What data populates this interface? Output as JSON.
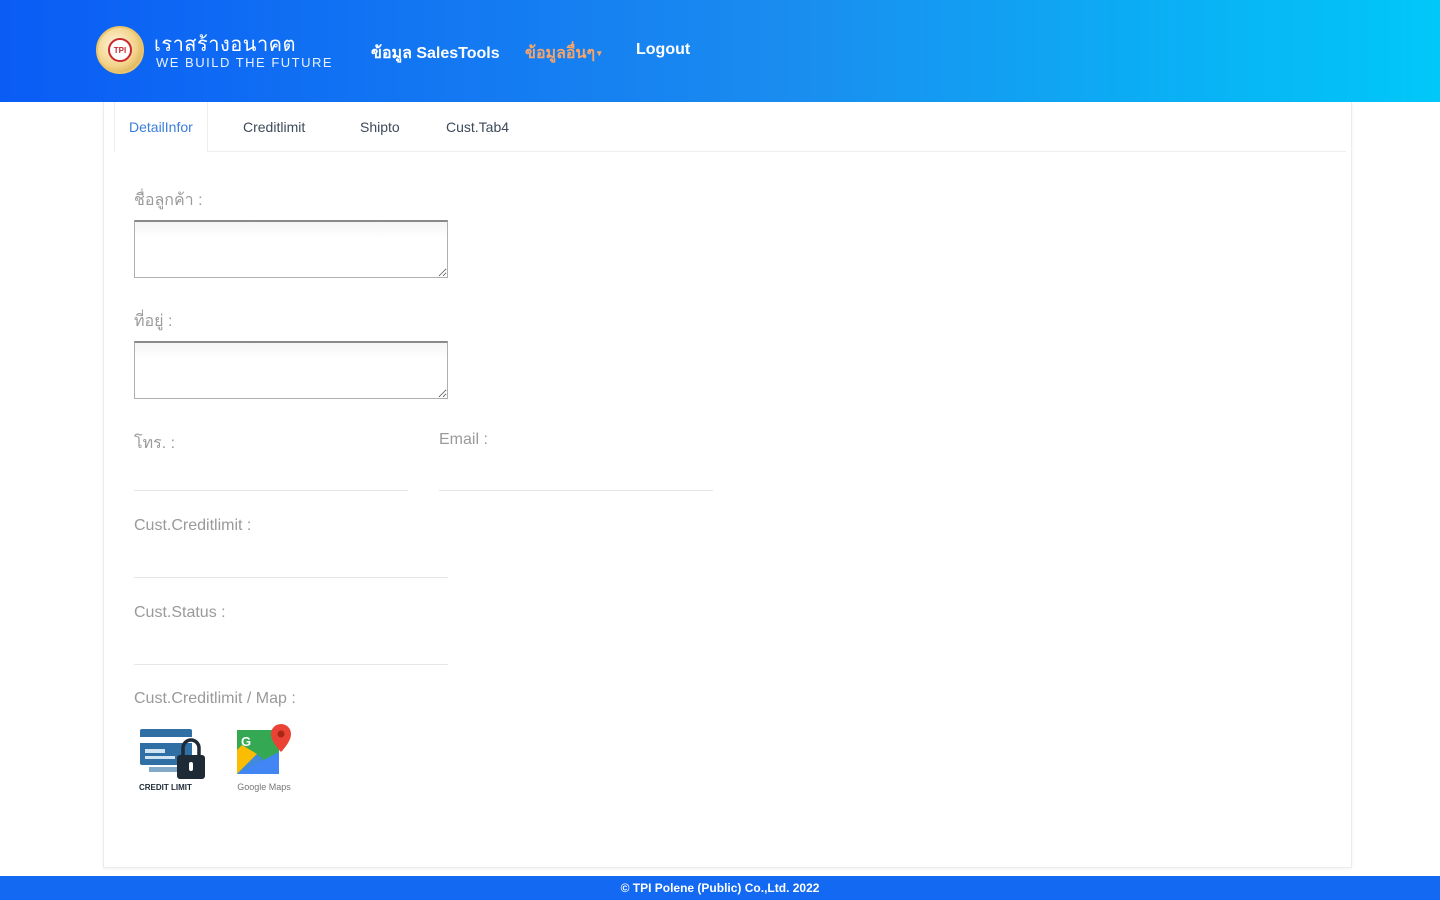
{
  "brand": {
    "logo_text": "TPI",
    "name_th": "เราสร้างอนาคต",
    "tagline": "WE BUILD THE FUTURE"
  },
  "nav": {
    "items": [
      {
        "label": "ข้อมูล SalesTools"
      },
      {
        "label": "ข้อมูลอื่นๆ"
      },
      {
        "label": "Logout"
      }
    ],
    "dropdown_color": "#f5a46a"
  },
  "tabs": [
    {
      "label": "DetailInfor",
      "active": true
    },
    {
      "label": "Creditlimit",
      "active": false
    },
    {
      "label": "Shipto",
      "active": false
    },
    {
      "label": "Cust.Tab4",
      "active": false
    }
  ],
  "form": {
    "customer_name_label": "ชื่อลูกค้า :",
    "customer_name_value": "",
    "address_label": "ที่อยู่ :",
    "address_value": "",
    "phone_label": "โทร. :",
    "phone_value": "",
    "email_label": "Email :",
    "email_value": "",
    "credit_limit_label": "Cust.Creditlimit :",
    "credit_limit_value": "",
    "status_label": "Cust.Status :",
    "status_value": "",
    "links_label": "Cust.Creditlimit / Map :"
  },
  "links": {
    "credit_caption": "CREDIT LIMIT",
    "maps_caption": "Google Maps"
  },
  "footer": {
    "text": "© TPI Polene (Public) Co.,Ltd. 2022"
  },
  "colors": {
    "header_start": "#0a5cf5",
    "header_end": "#00c8f8",
    "active_tab": "#3b7ddd",
    "footer": "#1469f2"
  }
}
